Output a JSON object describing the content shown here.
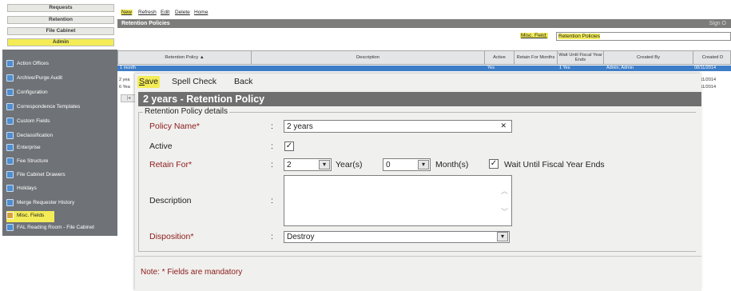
{
  "nav": {
    "top_items": [
      "Requests",
      "Retention",
      "File Cabinet",
      "Admin"
    ],
    "side_items": [
      {
        "label": "Action Offices",
        "icon": "action-offices-icon"
      },
      {
        "label": "Archive/Purge Audit",
        "icon": "archive-icon"
      },
      {
        "label": "Configuration",
        "icon": "configuration-icon"
      },
      {
        "label": "Correspondence Templates",
        "icon": "templates-icon"
      },
      {
        "label": "Custom Fields",
        "icon": "custom-fields-icon"
      },
      {
        "label": "Declassification",
        "icon": "declassification-icon"
      },
      {
        "label": "Enterprise",
        "icon": "enterprise-icon"
      },
      {
        "label": "Fee Structure",
        "icon": "fee-structure-icon"
      },
      {
        "label": "File Cabinet Drawers",
        "icon": "drawers-icon"
      },
      {
        "label": "Holidays",
        "icon": "holidays-icon"
      },
      {
        "label": "Merge Requester History",
        "icon": "merge-icon"
      },
      {
        "label": "Misc. Fields",
        "icon": "misc-fields-icon"
      },
      {
        "label": "FAL Reading Room - File Cabinet",
        "icon": "reading-room-icon"
      }
    ]
  },
  "list_screen": {
    "toolbar": [
      "New",
      "Refresh",
      "Edit",
      "Delete",
      "Home"
    ],
    "title": "Retention Policies",
    "title_right": "Sign O",
    "misc_field_label": "Misc. Field:",
    "misc_field_value": "Retention Policies",
    "columns": [
      "Retention Policy ▲",
      "Description",
      "Active",
      "Retain For Months",
      "Wait Until Fiscal Year Ends",
      "Created By",
      "Created D"
    ],
    "rows": [
      {
        "policy": "1 month",
        "active": "Yes",
        "wait": "1 Yes",
        "created_by": "Admin, Admin",
        "date": "08/11/2014"
      },
      {
        "policy": "2 yea",
        "active": "",
        "wait": "",
        "created_by": "",
        "date": "/11/2014"
      },
      {
        "policy": "6 Yea",
        "active": "",
        "wait": "",
        "created_by": "",
        "date": "/11/2014"
      }
    ]
  },
  "modal": {
    "toolbar": {
      "save": "Save",
      "save_hotkey": "S",
      "save_rest": "ave",
      "spell_check": "Spell Check",
      "back": "Back"
    },
    "title": "2 years - Retention Policy",
    "section_legend": "Retention Policy details",
    "fields": {
      "policy_name_label": "Policy Name*",
      "policy_name_value": "2 years",
      "active_label": "Active",
      "active_checked": true,
      "retain_for_label": "Retain For*",
      "retain_years": "2",
      "years_unit": "Year(s)",
      "retain_months": "0",
      "months_unit": "Month(s)",
      "wait_label": "Wait Until Fiscal Year Ends",
      "wait_checked": true,
      "description_label": "Description",
      "description_value": "",
      "disposition_label": "Disposition*",
      "disposition_value": "Destroy"
    },
    "colon": ":",
    "note": "Note: * Fields are mandatory"
  },
  "colors": {
    "highlight": "#f3ec57",
    "header_gray": "#6f6f6f",
    "required_red": "#8b1a1a",
    "selected_row": "#3d7dc7"
  }
}
